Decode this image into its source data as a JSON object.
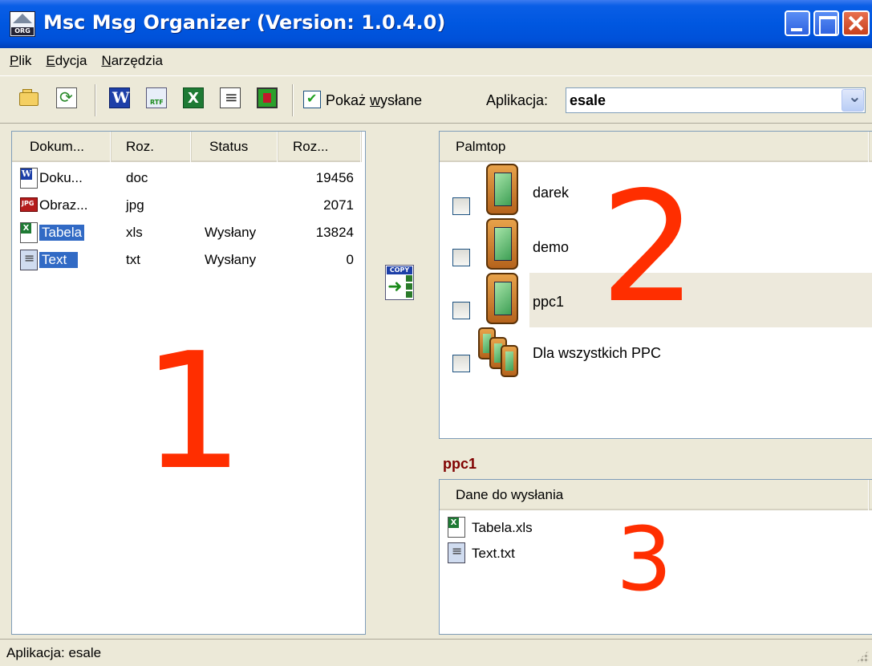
{
  "window": {
    "title": "Msc Msg Organizer (Version: 1.0.4.0)"
  },
  "menu": {
    "items": [
      {
        "prefix": "",
        "accel": "P",
        "rest": "lik"
      },
      {
        "prefix": "",
        "accel": "E",
        "rest": "dycja"
      },
      {
        "prefix": "",
        "accel": "N",
        "rest": "arzędzia"
      }
    ]
  },
  "toolbar": {
    "icons": [
      "open-folder-icon",
      "refresh-icon",
      "word-icon",
      "rtf-icon",
      "excel-icon",
      "notepad-icon",
      "image-icon"
    ],
    "show_sent": {
      "label_prefix": "Pokaż ",
      "label_accel": "w",
      "label_rest": "ysłane",
      "checked": true
    },
    "application": {
      "label": "Aplikacja:",
      "value": "esale"
    }
  },
  "documents": {
    "columns": [
      "Dokum...",
      "Roz.",
      "Status",
      "Roz..."
    ],
    "rows": [
      {
        "name": "Doku...",
        "ext": "doc",
        "status": "",
        "size": "19456",
        "icon": "word-document-icon",
        "selected": false
      },
      {
        "name": "Obraz...",
        "ext": "jpg",
        "status": "",
        "size": "2071",
        "icon": "jpg-image-icon",
        "selected": false
      },
      {
        "name": "Tabela",
        "ext": "xls",
        "status": "Wysłany",
        "size": "13824",
        "icon": "excel-document-icon",
        "selected": true
      },
      {
        "name": "Text",
        "ext": "txt",
        "status": "Wysłany",
        "size": "0",
        "icon": "text-document-icon",
        "selected": true
      }
    ],
    "overlay_number": "1"
  },
  "copy_button": {
    "tag": "COPY"
  },
  "palmtops": {
    "column": "Palmtop",
    "items": [
      {
        "label": "darek",
        "checked": false,
        "highlighted": false
      },
      {
        "label": "demo",
        "checked": false,
        "highlighted": false
      },
      {
        "label": "ppc1",
        "checked": false,
        "highlighted": true
      },
      {
        "label": "Dla wszystkich PPC",
        "checked": false,
        "highlighted": false
      }
    ],
    "overlay_number": "2"
  },
  "selected_pda": {
    "title": "ppc1"
  },
  "data_to_send": {
    "column": "Dane do wysłania",
    "items": [
      {
        "label": "Tabela.xls",
        "icon": "excel-document-icon"
      },
      {
        "label": "Text.txt",
        "icon": "text-document-icon"
      }
    ],
    "overlay_number": "3"
  },
  "status": {
    "text": "Aplikacja: esale"
  },
  "colors": {
    "titlebar": "#0057e0",
    "selection": "#316ac5",
    "overlay_number": "#ff2e00",
    "pda_title": "#800000"
  }
}
